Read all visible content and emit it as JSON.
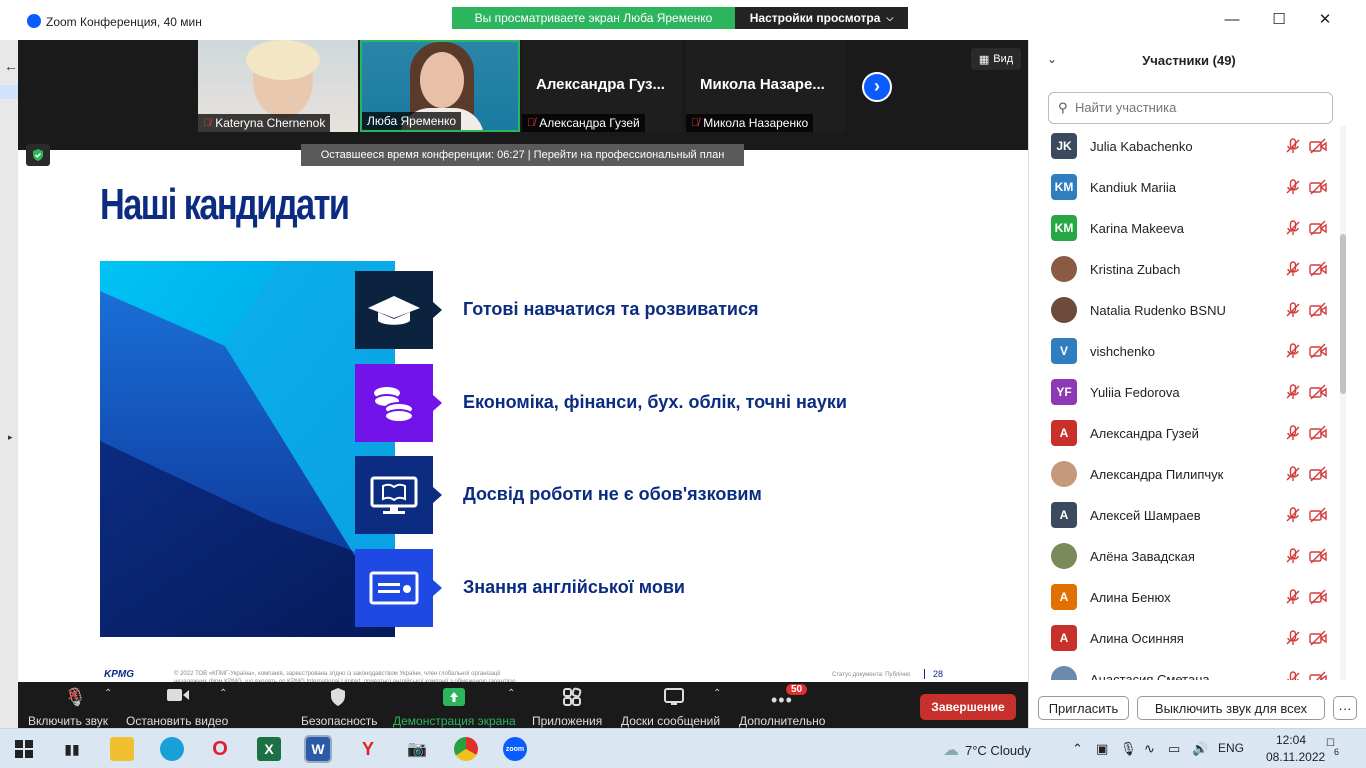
{
  "window": {
    "title": "Zoom Конференция, 40 мин",
    "share_banner": "Вы просматриваете экран Люба Яременко",
    "view_settings": "Настройки просмотра"
  },
  "videos": [
    {
      "name": "Kateryna Chernenok",
      "muted": true
    },
    {
      "name": "Люба Яременко",
      "muted": false
    },
    {
      "name": "Александра Гузей",
      "display": "Александра  Гуз...",
      "muted": true
    },
    {
      "name": "Микола Назаренко",
      "display": "Микола  Назаре...",
      "muted": true
    }
  ],
  "view_label": "Вид",
  "time_banner": "Оставшееся время конференции: 06:27 | Перейти на профессиональный план",
  "slide": {
    "title": "Наші кандидати",
    "items": [
      {
        "text": "Готові навчатися та розвиватися",
        "icon": "graduation-cap-icon",
        "color": "#0c2340"
      },
      {
        "text": "Економіка, фінанси, бух. облік, точні науки",
        "icon": "coins-icon",
        "color": "#7213ea"
      },
      {
        "text": "Досвід роботи не є обов'язковим",
        "icon": "monitor-book-icon",
        "color": "#0c2c82"
      },
      {
        "text": "Знання англійської мови",
        "icon": "certificate-icon",
        "color": "#1e49e2"
      }
    ],
    "footer_logo": "KPMG",
    "footer_text": "© 2022 ТОВ «КПМГ-Україна», компанія, зареєстрована згідно із законодавством України, член глобальної організації незалежних фірм KPMG, що входять до KPMG International Limited, приватної англійської компанії з обмеженою гарантією.",
    "status": "Статус документа: Публічно",
    "page": "28"
  },
  "toolbar": {
    "mute": "Включить звук",
    "video": "Остановить видео",
    "security": "Безопасность",
    "share": "Демонстрация экрана",
    "apps": "Приложения",
    "whiteboards": "Доски сообщений",
    "more": "Дополнительно",
    "more_badge": "50",
    "end": "Завершение"
  },
  "participants_panel": {
    "title": "Участники (49)",
    "search_placeholder": "Найти участника",
    "invite": "Пригласить",
    "mute_all": "Выключить звук для всех",
    "more": "···",
    "list": [
      {
        "initials": "JK",
        "name": "Julia Kabachenko",
        "color": "#3c4a5f",
        "photo": false
      },
      {
        "initials": "KM",
        "name": "Kandiuk Mariia",
        "color": "#2f7fc0",
        "photo": false
      },
      {
        "initials": "KM",
        "name": "Karina Makeeva",
        "color": "#27a844",
        "photo": false
      },
      {
        "initials": "",
        "name": "Kristina Zubach",
        "color": "#8a5a44",
        "photo": true
      },
      {
        "initials": "",
        "name": "Natalia Rudenko BSNU",
        "color": "#6d4b3a",
        "photo": true
      },
      {
        "initials": "V",
        "name": "vishchenko",
        "color": "#2f7fc0",
        "photo": false
      },
      {
        "initials": "YF",
        "name": "Yuliia Fedorova",
        "color": "#8e3ab5",
        "photo": false
      },
      {
        "initials": "А",
        "name": "Александра Гузей",
        "color": "#c8302c",
        "photo": false
      },
      {
        "initials": "",
        "name": "Александра Пилипчук",
        "color": "#c49a7a",
        "photo": true
      },
      {
        "initials": "А",
        "name": "Алексей Шамраев",
        "color": "#3c4a5f",
        "photo": false
      },
      {
        "initials": "",
        "name": "Алёна Завадская",
        "color": "#7a8a5a",
        "photo": true
      },
      {
        "initials": "А",
        "name": "Алина Бенюх",
        "color": "#e07000",
        "photo": false
      },
      {
        "initials": "А",
        "name": "Алина Осинняя",
        "color": "#c8302c",
        "photo": false
      },
      {
        "initials": "",
        "name": "Анастасия Сметана",
        "color": "#6a8ab0",
        "photo": true
      }
    ]
  },
  "taskbar": {
    "weather": "7°C  Cloudy",
    "lang": "ENG",
    "time": "12:04",
    "date": "08.11.2022",
    "notifications": "6"
  }
}
